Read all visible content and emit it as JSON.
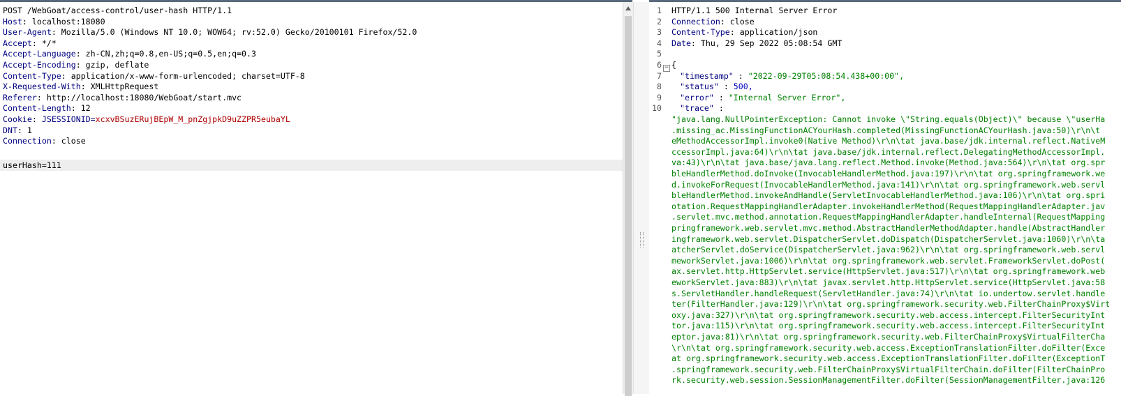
{
  "request": {
    "request_line": "POST /WebGoat/access-control/user-hash HTTP/1.1",
    "headers": [
      {
        "name": "Host",
        "value": " localhost:18080"
      },
      {
        "name": "User-Agent",
        "value": " Mozilla/5.0 (Windows NT 10.0; WOW64; rv:52.0) Gecko/20100101 Firefox/52.0"
      },
      {
        "name": "Accept",
        "value": " */*"
      },
      {
        "name": "Accept-Language",
        "value": " zh-CN,zh;q=0.8,en-US;q=0.5,en;q=0.3"
      },
      {
        "name": "Accept-Encoding",
        "value": " gzip, deflate"
      },
      {
        "name": "Content-Type",
        "value": " application/x-www-form-urlencoded; charset=UTF-8"
      },
      {
        "name": "X-Requested-With",
        "value": " XMLHttpRequest"
      },
      {
        "name": "Referer",
        "value": " http://localhost:18080/WebGoat/start.mvc"
      },
      {
        "name": "Content-Length",
        "value": " 12"
      }
    ],
    "cookie": {
      "name": "Cookie",
      "cookie_name": " JSESSIONID=",
      "cookie_value": "xcxvBSuzERujBEpW_M_pnZgjpkD9uZZPR5eubaYL"
    },
    "headers_after": [
      {
        "name": "DNT",
        "value": " 1"
      },
      {
        "name": "Connection",
        "value": " close"
      }
    ],
    "body": "userHash=111"
  },
  "response": {
    "line_numbers": [
      "1",
      "2",
      "3",
      "4",
      "5",
      "6",
      "7",
      "8",
      "9",
      "10"
    ],
    "status_line": "HTTP/1.1 500 Internal Server Error",
    "headers": [
      {
        "name": "Connection",
        "value": " close"
      },
      {
        "name": "Content-Type",
        "value": " application/json"
      },
      {
        "name": "Date",
        "value": " Thu, 29 Sep 2022 05:08:54 GMT"
      }
    ],
    "fold_marker": "−",
    "open_brace": "{",
    "json": {
      "timestamp_key": "\"timestamp\"",
      "timestamp_sep": " : ",
      "timestamp_val": "\"2022-09-29T05:08:54.438+00:00\",",
      "status_key": "\"status\"",
      "status_sep": " : ",
      "status_val": "500,",
      "error_key": "\"error\"",
      "error_sep": " : ",
      "error_val": "\"Internal Server Error\",",
      "trace_key": "\"trace\"",
      "trace_sep": " :"
    },
    "trace_lines": [
      "\"java.lang.NullPointerException: Cannot invoke \\\"String.equals(Object)\\\" because \\\"userHa",
      ".missing_ac.MissingFunctionACYourHash.completed(MissingFunctionACYourHash.java:50)\\r\\n\\t",
      "eMethodAccessorImpl.invoke0(Native Method)\\r\\n\\tat java.base/jdk.internal.reflect.NativeM",
      "ccessorImpl.java:64)\\r\\n\\tat java.base/jdk.internal.reflect.DelegatingMethodAccessorImpl.",
      "va:43)\\r\\n\\tat java.base/java.lang.reflect.Method.invoke(Method.java:564)\\r\\n\\tat org.spr",
      "bleHandlerMethod.doInvoke(InvocableHandlerMethod.java:197)\\r\\n\\tat org.springframework.we",
      "d.invokeForRequest(InvocableHandlerMethod.java:141)\\r\\n\\tat org.springframework.web.servl",
      "bleHandlerMethod.invokeAndHandle(ServletInvocableHandlerMethod.java:106)\\r\\n\\tat org.spri",
      "otation.RequestMappingHandlerAdapter.invokeHandlerMethod(RequestMappingHandlerAdapter.jav",
      ".servlet.mvc.method.annotation.RequestMappingHandlerAdapter.handleInternal(RequestMapping",
      "pringframework.web.servlet.mvc.method.AbstractHandlerMethodAdapter.handle(AbstractHandler",
      "ingframework.web.servlet.DispatcherServlet.doDispatch(DispatcherServlet.java:1060)\\r\\n\\ta",
      "atcherServlet.doService(DispatcherServlet.java:962)\\r\\n\\tat org.springframework.web.servl",
      "meworkServlet.java:1006)\\r\\n\\tat org.springframework.web.servlet.FrameworkServlet.doPost(",
      "ax.servlet.http.HttpServlet.service(HttpServlet.java:517)\\r\\n\\tat org.springframework.web",
      "eworkServlet.java:883)\\r\\n\\tat javax.servlet.http.HttpServlet.service(HttpServlet.java:58",
      "s.ServletHandler.handleRequest(ServletHandler.java:74)\\r\\n\\tat io.undertow.servlet.handle",
      "ter(FilterHandler.java:129)\\r\\n\\tat org.springframework.security.web.FilterChainProxy$Virt",
      "oxy.java:327)\\r\\n\\tat org.springframework.security.web.access.intercept.FilterSecurityInt",
      "tor.java:115)\\r\\n\\tat org.springframework.security.web.access.intercept.FilterSecurityInt",
      "eptor.java:81)\\r\\n\\tat org.springframework.security.web.FilterChainProxy$VirtualFilterCha",
      "\\r\\n\\tat org.springframework.security.web.access.ExceptionTranslationFilter.doFilter(Exce",
      "at org.springframework.security.web.access.ExceptionTranslationFilter.doFilter(ExceptionT",
      ".springframework.security.web.FilterChainProxy$VirtualFilterChain.doFilter(FilterChainPro",
      "rk.security.web.session.SessionManagementFilter.doFilter(SessionManagementFilter.java:126"
    ]
  }
}
